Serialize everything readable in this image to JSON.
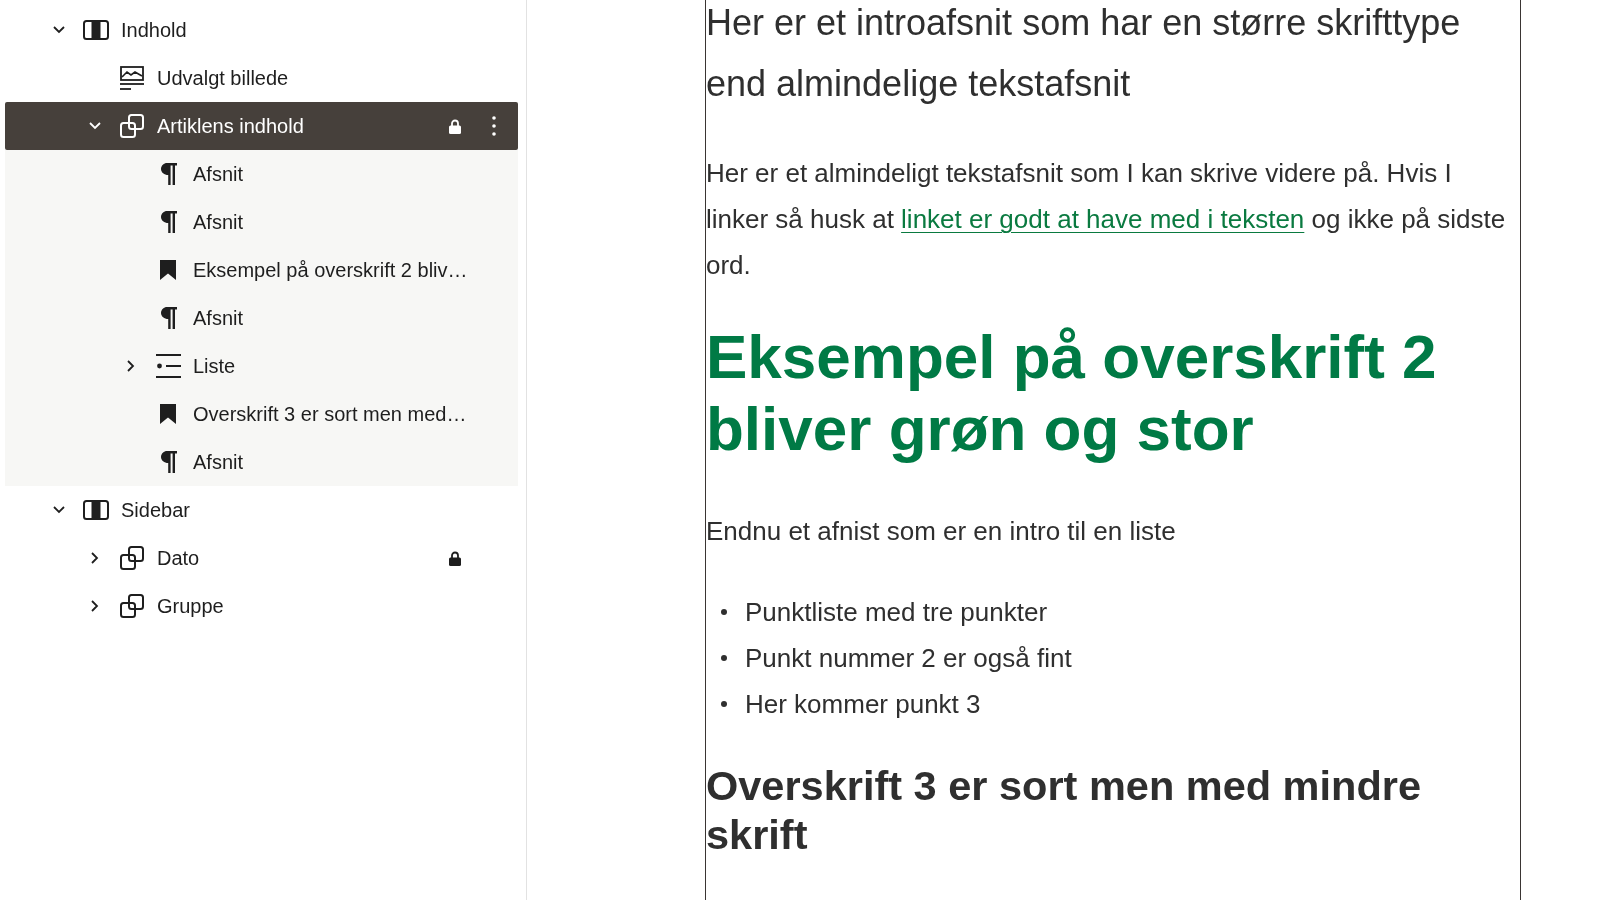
{
  "list_view": {
    "items": [
      {
        "label": "Indhold",
        "kind": "columns",
        "selected": false,
        "locked": false,
        "expanded": true,
        "children": [
          {
            "label": "Udvalgt billede",
            "kind": "featured-image",
            "selected": false,
            "locked": false
          },
          {
            "label": "Artiklens indhold",
            "kind": "group",
            "selected": true,
            "locked": true,
            "expanded": true,
            "children": [
              {
                "label": "Afsnit",
                "kind": "paragraph",
                "selected": false,
                "locked": false
              },
              {
                "label": "Afsnit",
                "kind": "paragraph",
                "selected": false,
                "locked": false
              },
              {
                "label": "Eksempel på overskrift 2 bliv…",
                "kind": "heading",
                "selected": false,
                "locked": false
              },
              {
                "label": "Afsnit",
                "kind": "paragraph",
                "selected": false,
                "locked": false
              },
              {
                "label": "Liste",
                "kind": "list",
                "selected": false,
                "locked": false,
                "expanded": false
              },
              {
                "label": "Overskrift 3 er sort men med…",
                "kind": "heading",
                "selected": false,
                "locked": false
              },
              {
                "label": "Afsnit",
                "kind": "paragraph",
                "selected": false,
                "locked": false
              }
            ]
          }
        ]
      },
      {
        "label": "Sidebar",
        "kind": "columns",
        "selected": false,
        "locked": false,
        "expanded": true,
        "children": [
          {
            "label": "Dato",
            "kind": "group",
            "selected": false,
            "locked": true,
            "expanded": false
          },
          {
            "label": "Gruppe",
            "kind": "group",
            "selected": false,
            "locked": false,
            "expanded": false
          }
        ]
      }
    ]
  },
  "editor": {
    "blocks": [
      {
        "kind": "intro",
        "text": "Her er et introafsnit som har en større skrifttype end almindelige tekstafsnit"
      },
      {
        "kind": "paragraph",
        "text": "Her er et almindeligt tekstafsnit som I kan skrive videre på. Hvis I linker så husk at ",
        "link": "linket er godt at have med i teksten",
        "text_after": " og ikke på sidste ord."
      },
      {
        "kind": "heading-2",
        "text": "Eksempel på overskrift 2 bliver grøn og stor"
      },
      {
        "kind": "paragraph",
        "text": "Endnu et afnist som er en intro til en liste"
      },
      {
        "kind": "list",
        "items": [
          "Punktliste med tre punkter",
          "Punkt nummer 2 er også fint",
          "Her kommer punkt 3"
        ]
      },
      {
        "kind": "heading-3",
        "text": "Overskrift 3 er sort men med mindre skrift"
      }
    ]
  }
}
